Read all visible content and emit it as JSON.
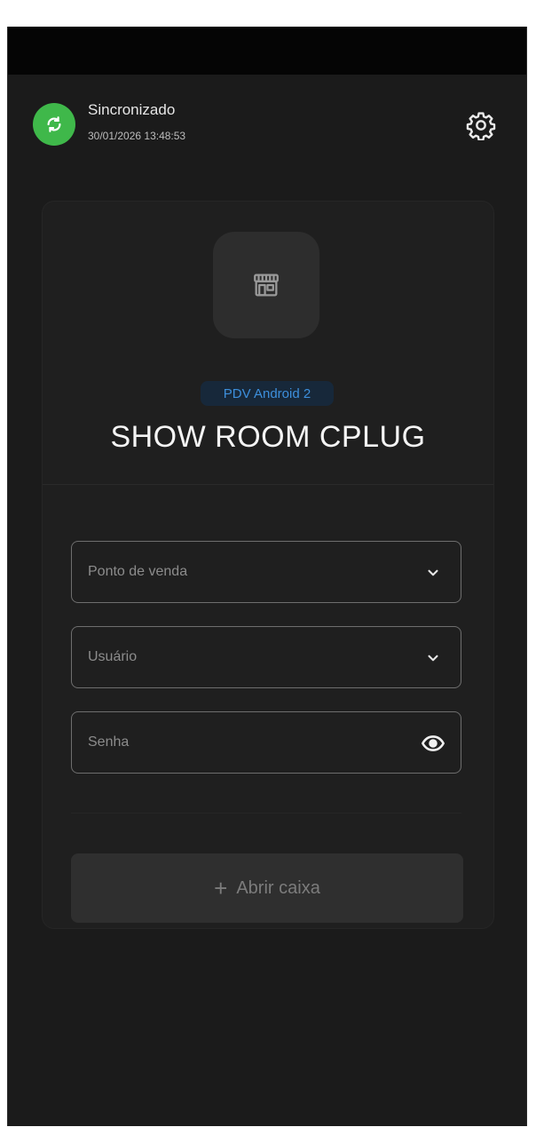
{
  "sync": {
    "status_label": "Sincronizado",
    "timestamp": "30/01/2026 13:48:53",
    "icon": "sync-icon",
    "badge_color": "#3fb84a"
  },
  "header": {
    "settings_icon": "gear-icon"
  },
  "store": {
    "icon": "store-icon",
    "terminal_label": "PDV Android 2",
    "name": "SHOW ROOM CPLUG"
  },
  "form": {
    "point_of_sale": {
      "placeholder": "Ponto de venda",
      "icon": "chevron-down-icon"
    },
    "user": {
      "placeholder": "Usuário",
      "icon": "chevron-down-icon"
    },
    "password": {
      "placeholder": "Senha",
      "icon": "eye-icon"
    }
  },
  "actions": {
    "open_register_label": "Abrir caixa",
    "open_register_icon": "plus-icon"
  }
}
